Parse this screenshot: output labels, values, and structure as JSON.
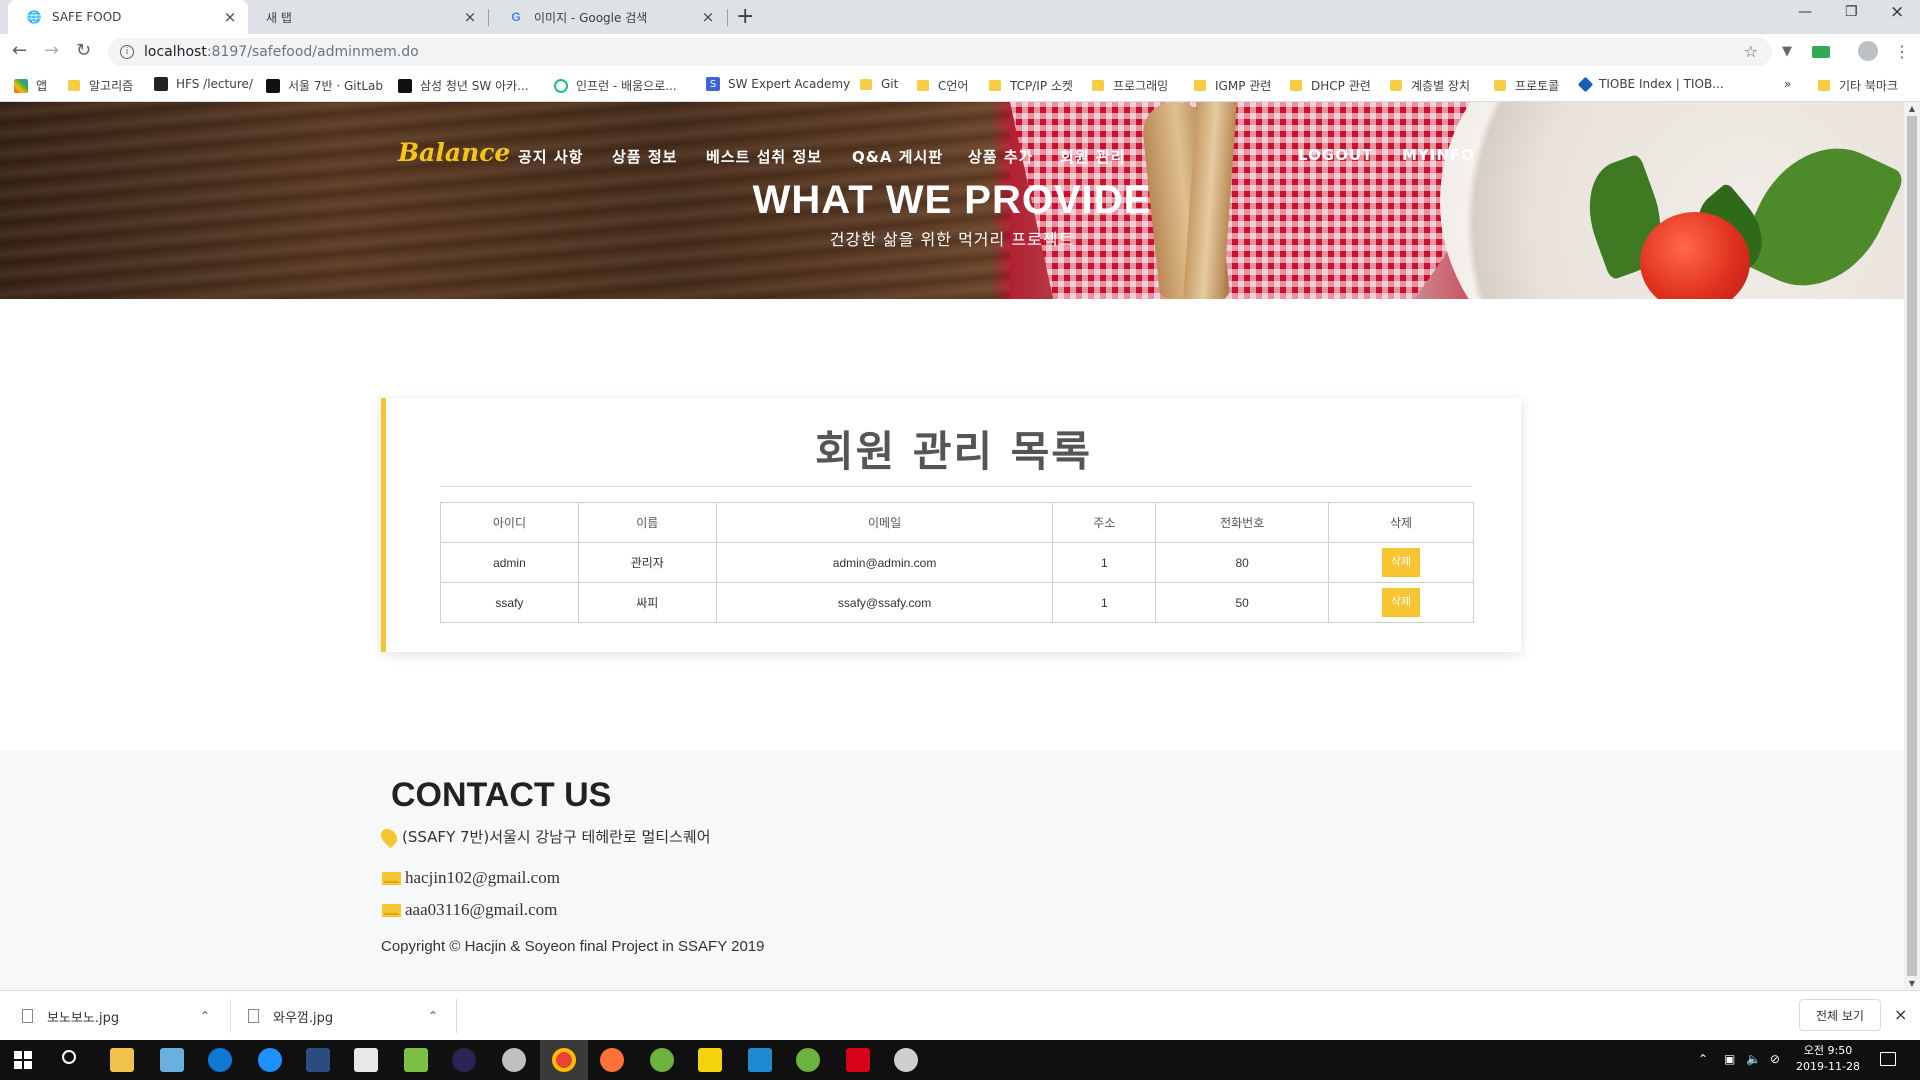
{
  "browser": {
    "tabs": [
      {
        "title": "SAFE FOOD",
        "active": true
      },
      {
        "title": "새 탭",
        "active": false
      },
      {
        "title": "이미지 - Google 검색",
        "active": false
      }
    ],
    "url_host": "localhost",
    "url_path": ":8197/safefood/adminmem.do",
    "bookmarks": [
      "앱",
      "알고리즘",
      "HFS /lecture/",
      "서울 7반 · GitLab",
      "삼성 청년 SW 아카...",
      "인프런 - 배움으로...",
      "SW Expert Academy",
      "Git",
      "C언어",
      "TCP/IP 소켓",
      "프로그래밍",
      "IGMP 관련",
      "DHCP 관련",
      "계층별 장치",
      "프로토콜",
      "TIOBE Index | TIOB...",
      "기타 북마크"
    ]
  },
  "site": {
    "brand": "Balance",
    "menu": [
      "공지 사항",
      "상품 정보",
      "베스트 섭취 정보",
      "Q&A 게시판",
      "상품 추가",
      "회원 관리",
      "LOGOUT",
      "MYINFO"
    ],
    "hero_title": "WHAT WE PROVIDE",
    "hero_subtitle": "건강한 삶을 위한 먹거리 프로젝트"
  },
  "members": {
    "title": "회원 관리 목록",
    "columns": [
      "아이디",
      "이름",
      "이메일",
      "주소",
      "전화번호",
      "삭제"
    ],
    "rows": [
      {
        "id": "admin",
        "name": "관리자",
        "email": "admin@admin.com",
        "address": "1",
        "phone": "80",
        "delete_label": "삭제"
      },
      {
        "id": "ssafy",
        "name": "싸피",
        "email": "ssafy@ssafy.com",
        "address": "1",
        "phone": "50",
        "delete_label": "삭제"
      }
    ]
  },
  "footer": {
    "title": "CONTACT US",
    "address": "(SSAFY 7반)서울시 강남구 테헤란로 멀티스퀘어",
    "emails": [
      "hacjin102@gmail.com",
      "aaa03116@gmail.com"
    ],
    "copyright": "Copyright © Hacjin & Soyeon final Project in SSAFY 2019"
  },
  "downloads": {
    "items": [
      "보노보노.jpg",
      "와우껌.jpg"
    ],
    "show_all": "전체 보기"
  },
  "taskbar": {
    "time": "오전 9:50",
    "date": "2019-11-28"
  },
  "colors": {
    "accent": "#f7c531",
    "brand": "#f5c518"
  }
}
